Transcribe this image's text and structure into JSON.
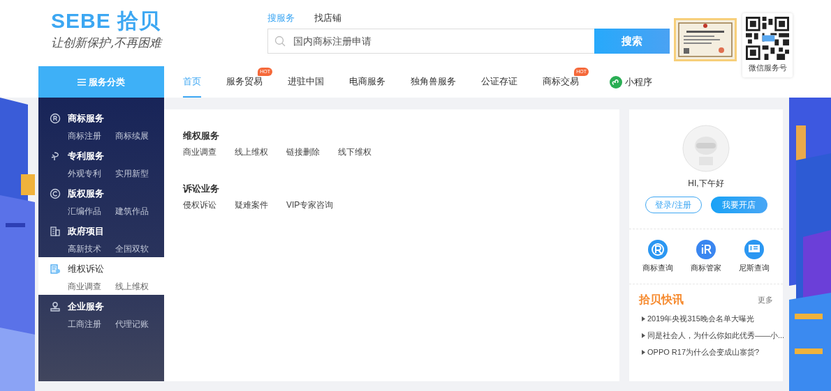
{
  "logo": {
    "brand": "SEBE 拾贝",
    "slogan": "让创新保护,不再困难"
  },
  "search": {
    "tabs": [
      {
        "label": "搜服务",
        "selected": true
      },
      {
        "label": "找店铺",
        "selected": false
      }
    ],
    "placeholder": "国内商标注册申请",
    "button": "搜索"
  },
  "qr": {
    "caption": "微信服务号"
  },
  "category_button": "服务分类",
  "nav": [
    {
      "label": "首页",
      "selected": true
    },
    {
      "label": "服务贸易",
      "selected": false,
      "badge": "HOT"
    },
    {
      "label": "进驻中国",
      "selected": false
    },
    {
      "label": "电商服务",
      "selected": false
    },
    {
      "label": "独角兽服务",
      "selected": false
    },
    {
      "label": "公证存证",
      "selected": false
    },
    {
      "label": "商标交易",
      "selected": false,
      "badge": "HOT"
    }
  ],
  "mini_program": "小程序",
  "sidebar": [
    {
      "kind": "registered",
      "title": "商标服务",
      "links": [
        "商标注册",
        "商标续展"
      ],
      "selected": false
    },
    {
      "kind": "patent",
      "title": "专利服务",
      "links": [
        "外观专利",
        "实用新型"
      ],
      "selected": false
    },
    {
      "kind": "copyright",
      "title": "版权服务",
      "links": [
        "汇编作品",
        "建筑作品"
      ],
      "selected": false
    },
    {
      "kind": "building",
      "title": "政府项目",
      "links": [
        "高新技术",
        "全国双软"
      ],
      "selected": false
    },
    {
      "kind": "document",
      "title": "维权诉讼",
      "links": [
        "商业调查",
        "线上维权"
      ],
      "selected": true
    },
    {
      "kind": "stamp",
      "title": "企业服务",
      "links": [
        "工商注册",
        "代理记账"
      ],
      "selected": false
    }
  ],
  "panel": {
    "sections": [
      {
        "title": "维权服务",
        "links": [
          "商业调查",
          "线上维权",
          "链接删除",
          "线下维权"
        ]
      },
      {
        "title": "诉讼业务",
        "links": [
          "侵权诉讼",
          "疑难案件",
          "VIP专家咨询"
        ]
      }
    ]
  },
  "user": {
    "greeting": "HI,下午好",
    "login": "登录/注册",
    "open_shop": "我要开店"
  },
  "tools": [
    {
      "kind": "r-circle",
      "label": "商标查询"
    },
    {
      "kind": "ir",
      "label": "商标管家"
    },
    {
      "kind": "monitor",
      "label": "尼斯查询"
    }
  ],
  "news": {
    "title": "拾贝快讯",
    "more": "更多",
    "items": [
      "2019年央视315晚会名单大曝光",
      "同是社会人，为什么你如此优秀——小...",
      "OPPO R17为什么会变成山寨货?"
    ]
  }
}
